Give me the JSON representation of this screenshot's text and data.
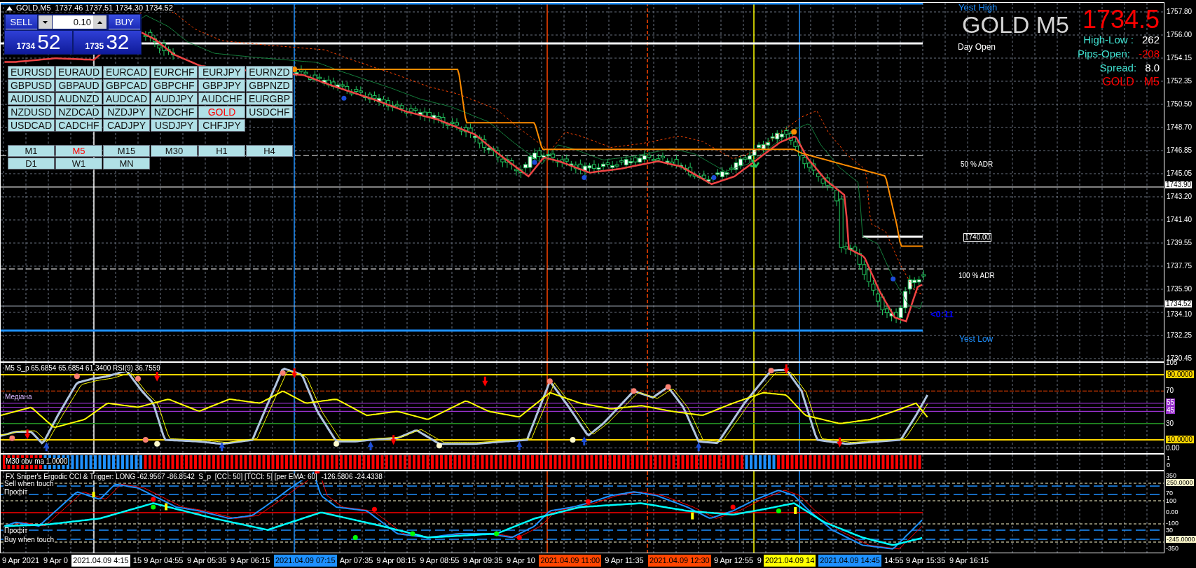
{
  "title_bar": {
    "text": "GOLD,M5  1737.46 1737.51 1734.30 1734.52"
  },
  "trade_panel": {
    "sell": {
      "label": "SELL",
      "price_head": "1734",
      "price_tail": "52"
    },
    "lot": "0.10",
    "buy": {
      "label": "BUY",
      "price_head": "1735",
      "price_tail": "32"
    }
  },
  "symbols": [
    {
      "label": "EURUSD",
      "selected": false
    },
    {
      "label": "EURAUD",
      "selected": false
    },
    {
      "label": "EURCAD",
      "selected": false
    },
    {
      "label": "EURCHF",
      "selected": false
    },
    {
      "label": "EURJPY",
      "selected": false
    },
    {
      "label": "EURNZD",
      "selected": false
    },
    {
      "label": "GBPUSD",
      "selected": false
    },
    {
      "label": "GBPAUD",
      "selected": false
    },
    {
      "label": "GBPCAD",
      "selected": false
    },
    {
      "label": "GBPCHF",
      "selected": false
    },
    {
      "label": "GBPJPY",
      "selected": false
    },
    {
      "label": "GBPNZD",
      "selected": false
    },
    {
      "label": "AUDUSD",
      "selected": false
    },
    {
      "label": "AUDNZD",
      "selected": false
    },
    {
      "label": "AUDCAD",
      "selected": false
    },
    {
      "label": "AUDJPY",
      "selected": false
    },
    {
      "label": "AUDCHF",
      "selected": false
    },
    {
      "label": "EURGBP",
      "selected": false
    },
    {
      "label": "NZDUSD",
      "selected": false
    },
    {
      "label": "NZDCAD",
      "selected": false
    },
    {
      "label": "NZDJPY",
      "selected": false
    },
    {
      "label": "NZDCHF",
      "selected": false
    },
    {
      "label": "GOLD",
      "selected": true
    },
    {
      "label": "USDCHF",
      "selected": false
    },
    {
      "label": "USDCAD",
      "selected": false
    },
    {
      "label": "CADCHF",
      "selected": false
    },
    {
      "label": "CADJPY",
      "selected": false
    },
    {
      "label": "USDJPY",
      "selected": false
    },
    {
      "label": "CHFJPY",
      "selected": false
    }
  ],
  "timeframes": [
    {
      "label": "M1",
      "selected": false
    },
    {
      "label": "M5",
      "selected": true
    },
    {
      "label": "M15",
      "selected": false
    },
    {
      "label": "M30",
      "selected": false
    },
    {
      "label": "H1",
      "selected": false
    },
    {
      "label": "H4",
      "selected": false
    },
    {
      "label": "D1",
      "selected": false
    },
    {
      "label": "W1",
      "selected": false
    },
    {
      "label": "MN",
      "selected": false
    }
  ],
  "info": {
    "yest_high": "Yest High",
    "symbol_title": "GOLD M5",
    "price": "1734.5",
    "stats": [
      {
        "label": "High-Low :",
        "value": "262",
        "kind": "plain"
      },
      {
        "label": "Pips-Open:",
        "value": "-208",
        "kind": "negative"
      },
      {
        "label": "Spread:",
        "value": "8.0",
        "kind": "plain"
      }
    ],
    "footer": [
      "GOLD",
      "M5"
    ]
  },
  "level_labels": {
    "day_open": "Day Open",
    "adr_50": "50 % ADR",
    "price_box": "1740.00",
    "adr_100": "100 % ADR",
    "countdown": "<0:11",
    "yest_low": "Yest Low"
  },
  "price_axis": {
    "ticks": [
      "1757.80",
      "1756.00",
      "1754.15",
      "1752.35",
      "1750.50",
      "1748.70",
      "1746.85",
      "1745.05",
      "1743.20",
      "1741.40",
      "1739.55",
      "1737.75",
      "1735.90",
      "1734.10",
      "1732.25",
      "1730.45"
    ],
    "markers": [
      "1743.90",
      "1734.52"
    ]
  },
  "rsi_panel": {
    "label": "M5 S_p 65.6854 65.6854 61.3400 RSI(9) 36.7559",
    "median": "Медіана",
    "axis": [
      {
        "text": "105",
        "kind": "tick"
      },
      {
        "text": "90.0000",
        "kind": "level"
      },
      {
        "text": "70",
        "kind": "tick"
      },
      {
        "text": "55",
        "kind": "band"
      },
      {
        "text": "45",
        "kind": "band"
      },
      {
        "text": "30",
        "kind": "tick"
      },
      {
        "text": "10.0000",
        "kind": "level"
      },
      {
        "text": "0.00",
        "kind": "tick"
      }
    ]
  },
  "obv_panel": {
    "label": "M30 obv ma 1.0000",
    "axis": [
      "1",
      "0"
    ]
  },
  "cci_panel": {
    "label": "FX Sniper's Ergodic CCI & Trigger: LONG -62.9567 -86.8542  S_p  [CCI: 50] [TCCI: 5] [per EMA: 60]  -126.5806 -24.4338",
    "notes": [
      "Sell when touch",
      "Профіт",
      "Профіт",
      "Buy when touch"
    ],
    "axis": [
      {
        "text": "350",
        "kind": "tick"
      },
      {
        "text": "250.0000",
        "kind": "level"
      },
      {
        "text": "70",
        "kind": "tick"
      },
      {
        "text": "100",
        "kind": "tick"
      },
      {
        "text": "0.00",
        "kind": "tick"
      },
      {
        "text": "-100",
        "kind": "tick"
      },
      {
        "text": "30",
        "kind": "tick"
      },
      {
        "text": "-245.0000",
        "kind": "level"
      },
      {
        "text": "-350",
        "kind": "tick"
      }
    ]
  },
  "time_axis": {
    "labels": [
      "9 Apr 2021",
      "9 Apr 0",
      "15",
      "9 Apr 04:55",
      "9 Apr 05:35",
      "9 Apr 06:15",
      "Apr 07:35",
      "9 Apr 08:15",
      "9 Apr 08:55",
      "9 Apr 09:35",
      "9 Apr 10",
      "9 Apr 11:35",
      "9 Apr 12:55",
      "9",
      "14:55",
      "9 Apr 15:35",
      "9 Apr 16:15"
    ],
    "markers": [
      {
        "text": "2021.04.09 4:15",
        "color": "#ffffff"
      },
      {
        "text": "2021.04.09 07:15",
        "color": "#1e90ff"
      },
      {
        "text": "2021.04.09 11:00",
        "color": "#ff4500"
      },
      {
        "text": "2021.04.09 12:30",
        "color": "#ff4500"
      },
      {
        "text": "2021.04.09 14",
        "color": "#ffff00"
      },
      {
        "text": "2021.04.09 14:45",
        "color": "#1e90ff"
      }
    ]
  }
}
